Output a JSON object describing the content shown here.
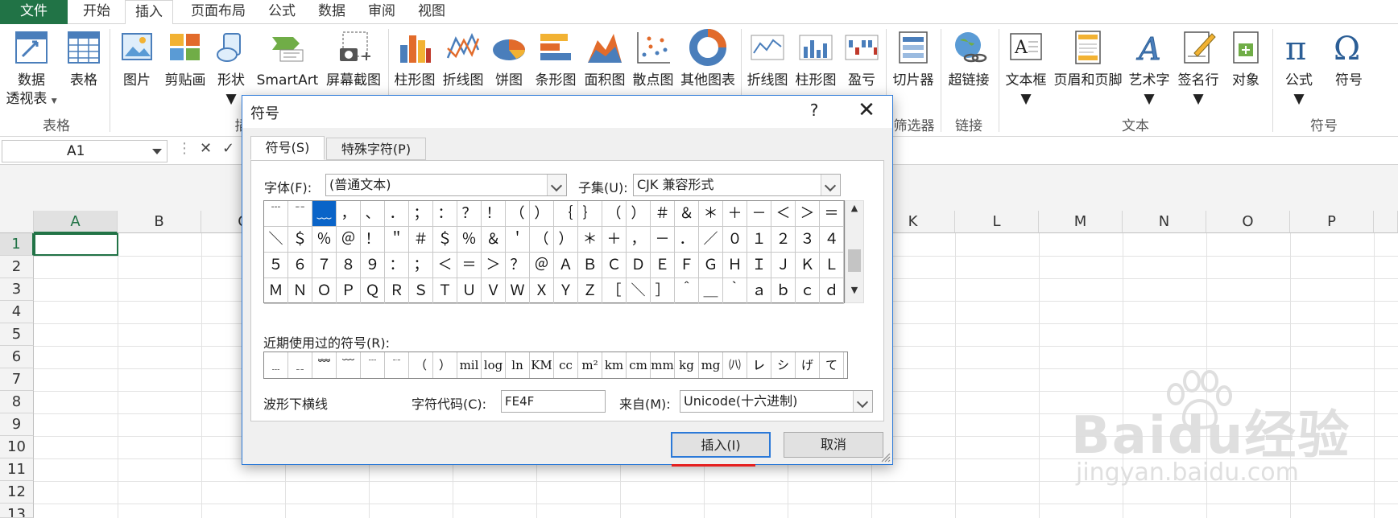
{
  "ribbon_tabs": [
    "文件",
    "开始",
    "插入",
    "页面布局",
    "公式",
    "数据",
    "审阅",
    "视图"
  ],
  "ribbon": {
    "buttons": [
      {
        "label": "数据",
        "label2": "透视表"
      },
      {
        "label": "表格",
        "label2": ""
      },
      {
        "label": "图片",
        "label2": ""
      },
      {
        "label": "剪贴画",
        "label2": ""
      },
      {
        "label": "形状",
        "label2": ""
      },
      {
        "label": "SmartArt",
        "label2": ""
      },
      {
        "label": "屏幕截图",
        "label2": ""
      },
      {
        "label": "柱形图",
        "label2": ""
      },
      {
        "label": "折线图",
        "label2": ""
      },
      {
        "label": "饼图",
        "label2": ""
      },
      {
        "label": "条形图",
        "label2": ""
      },
      {
        "label": "面积图",
        "label2": ""
      },
      {
        "label": "散点图",
        "label2": ""
      },
      {
        "label": "其他图表",
        "label2": ""
      },
      {
        "label": "折线图",
        "label2": ""
      },
      {
        "label": "柱形图",
        "label2": ""
      },
      {
        "label": "盈亏",
        "label2": ""
      },
      {
        "label": "切片器",
        "label2": ""
      },
      {
        "label": "超链接",
        "label2": ""
      },
      {
        "label": "文本框",
        "label2": ""
      },
      {
        "label": "页眉和页脚",
        "label2": ""
      },
      {
        "label": "艺术字",
        "label2": ""
      },
      {
        "label": "签名行",
        "label2": ""
      },
      {
        "label": "对象",
        "label2": ""
      },
      {
        "label": "公式",
        "label2": ""
      },
      {
        "label": "符号",
        "label2": ""
      }
    ],
    "groups": [
      "表格",
      "插",
      "筛选器",
      "链接",
      "文本",
      "符号"
    ]
  },
  "name_box": "A1",
  "columns": [
    "A",
    "B",
    "C",
    "D",
    "E",
    "F",
    "G",
    "H",
    "I",
    "J",
    "K",
    "L",
    "M",
    "N",
    "O",
    "P"
  ],
  "rows": [
    "1",
    "2",
    "3",
    "4",
    "5",
    "6",
    "7",
    "8",
    "9",
    "10",
    "11",
    "12",
    "13"
  ],
  "dialog": {
    "title": "符号",
    "help": "?",
    "close": "✕",
    "tabs": [
      "符号(S)",
      "特殊字符(P)"
    ],
    "font_label": "字体(F):",
    "font_value": "(普通文本)",
    "subset_label": "子集(U):",
    "subset_value": "CJK 兼容形式",
    "grid_rows": [
      [
        "﹉",
        "﹊",
        "﹏",
        "，",
        "、",
        "．",
        "；",
        "：",
        "？",
        "！",
        "（",
        "）",
        "｛",
        "｝",
        "（",
        "）",
        "＃",
        "＆",
        "＊",
        "＋",
        "－",
        "＜",
        "＞",
        "＝"
      ],
      [
        "＼",
        "＄",
        "％",
        "＠",
        "！",
        "＂",
        "＃",
        "＄",
        "％",
        "＆",
        "＇",
        "（",
        "）",
        "＊",
        "＋",
        "，",
        "－",
        "．",
        "／",
        "０",
        "１",
        "２",
        "３",
        "４"
      ],
      [
        "５",
        "６",
        "７",
        "８",
        "９",
        "：",
        "；",
        "＜",
        "＝",
        "＞",
        "？",
        "＠",
        "Ａ",
        "Ｂ",
        "Ｃ",
        "Ｄ",
        "Ｅ",
        "Ｆ",
        "Ｇ",
        "Ｈ",
        "Ｉ",
        "Ｊ",
        "Ｋ",
        "Ｌ"
      ],
      [
        "Ｍ",
        "Ｎ",
        "Ｏ",
        "Ｐ",
        "Ｑ",
        "Ｒ",
        "Ｓ",
        "Ｔ",
        "Ｕ",
        "Ｖ",
        "Ｗ",
        "Ｘ",
        "Ｙ",
        "Ｚ",
        "［",
        "＼",
        "］",
        "＾",
        "＿",
        "｀",
        "ａ",
        "ｂ",
        "ｃ",
        "ｄ"
      ]
    ],
    "recent_label": "近期使用过的符号(R):",
    "recent": [
      "﹍",
      "﹎",
      "﹌",
      "﹋",
      "﹉",
      "﹊",
      "（",
      "）",
      "mil",
      "log",
      "ln",
      "KM",
      "cc",
      "m²",
      "km",
      "cm",
      "mm",
      "kg",
      "mg",
      "㈧",
      "㆑",
      "シ",
      "げ",
      "て"
    ],
    "char_name": "波形下横线",
    "code_label": "字符代码(C):",
    "code_value": "FE4F",
    "from_label": "来自(M):",
    "from_value": "Unicode(十六进制)",
    "insert_label": "插入(I)",
    "cancel_label": "取消"
  },
  "watermark": {
    "big": "Baidu经验",
    "small": "jingyan.baidu.com"
  },
  "colors": {
    "excel_green": "#217346",
    "dialog_border": "#2b79d8",
    "selection": "#0a64c8",
    "highlight_red": "#e52020"
  }
}
